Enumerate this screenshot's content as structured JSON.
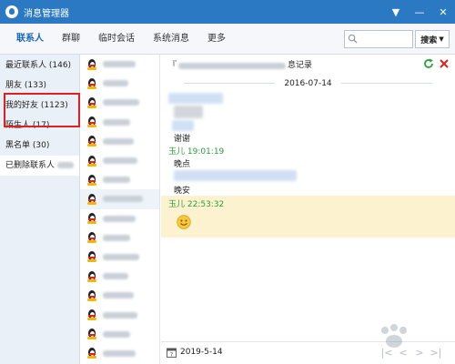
{
  "window": {
    "title": "消息管理器",
    "min_icon": "minimize-icon",
    "close_icon": "close-icon"
  },
  "tabs": [
    {
      "label": "联系人",
      "active": true
    },
    {
      "label": "群聊"
    },
    {
      "label": "临时会话"
    },
    {
      "label": "系统消息"
    },
    {
      "label": "更多"
    }
  ],
  "search": {
    "placeholder": "",
    "button_label": "搜索"
  },
  "categories": [
    {
      "label": "最近联系人 (146)"
    },
    {
      "label": "朋友 (133)"
    },
    {
      "label": "我的好友 (1123)"
    },
    {
      "label": "陌生人 (17)"
    },
    {
      "label": "黑名单 (30)"
    },
    {
      "label": "已删除联系人"
    }
  ],
  "messages": {
    "header_suffix": "息记录",
    "date": "2016-07-14",
    "lines": [
      {
        "text": "谢谢"
      },
      {
        "sender": "玉儿 19:01:19"
      },
      {
        "text": "晚点"
      },
      {
        "text": "晚安"
      },
      {
        "sender": "玉儿 22:53:32"
      }
    ],
    "footer_date": "2019-5-14"
  },
  "colors": {
    "titlebar": "#2b79c2",
    "accent": "#1a66b3",
    "highlight": "#fdf2cf",
    "sender": "#2a9b3a",
    "red_frame": "#e02020"
  }
}
